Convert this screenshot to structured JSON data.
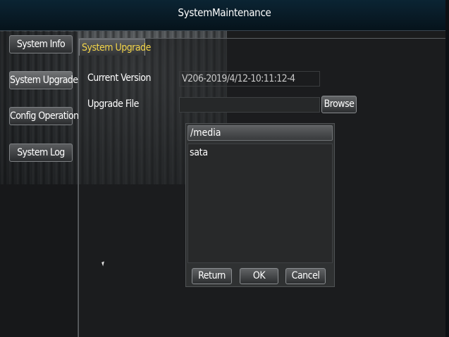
{
  "window": {
    "title": "SystemMaintenance"
  },
  "sidebar": {
    "items": [
      {
        "label": "System Info"
      },
      {
        "label": "System Upgrade"
      },
      {
        "label": "Config Operation"
      },
      {
        "label": "System Log"
      }
    ]
  },
  "tab": {
    "label": "System Upgrade"
  },
  "form": {
    "current_version_label": "Current Version",
    "current_version_value": "V206-2019/4/12-10:11:12-4",
    "upgrade_file_label": "Upgrade File",
    "upgrade_file_value": "",
    "browse_label": "Browse"
  },
  "file_dialog": {
    "path": "/media",
    "items": [
      "sata"
    ],
    "return_label": "Return",
    "ok_label": "OK",
    "cancel_label": "Cancel"
  },
  "colors": {
    "tab_text": "#f3d54a",
    "title_bar": "#0b2433"
  },
  "icons": {
    "cursor": "mouse-cursor-icon"
  }
}
